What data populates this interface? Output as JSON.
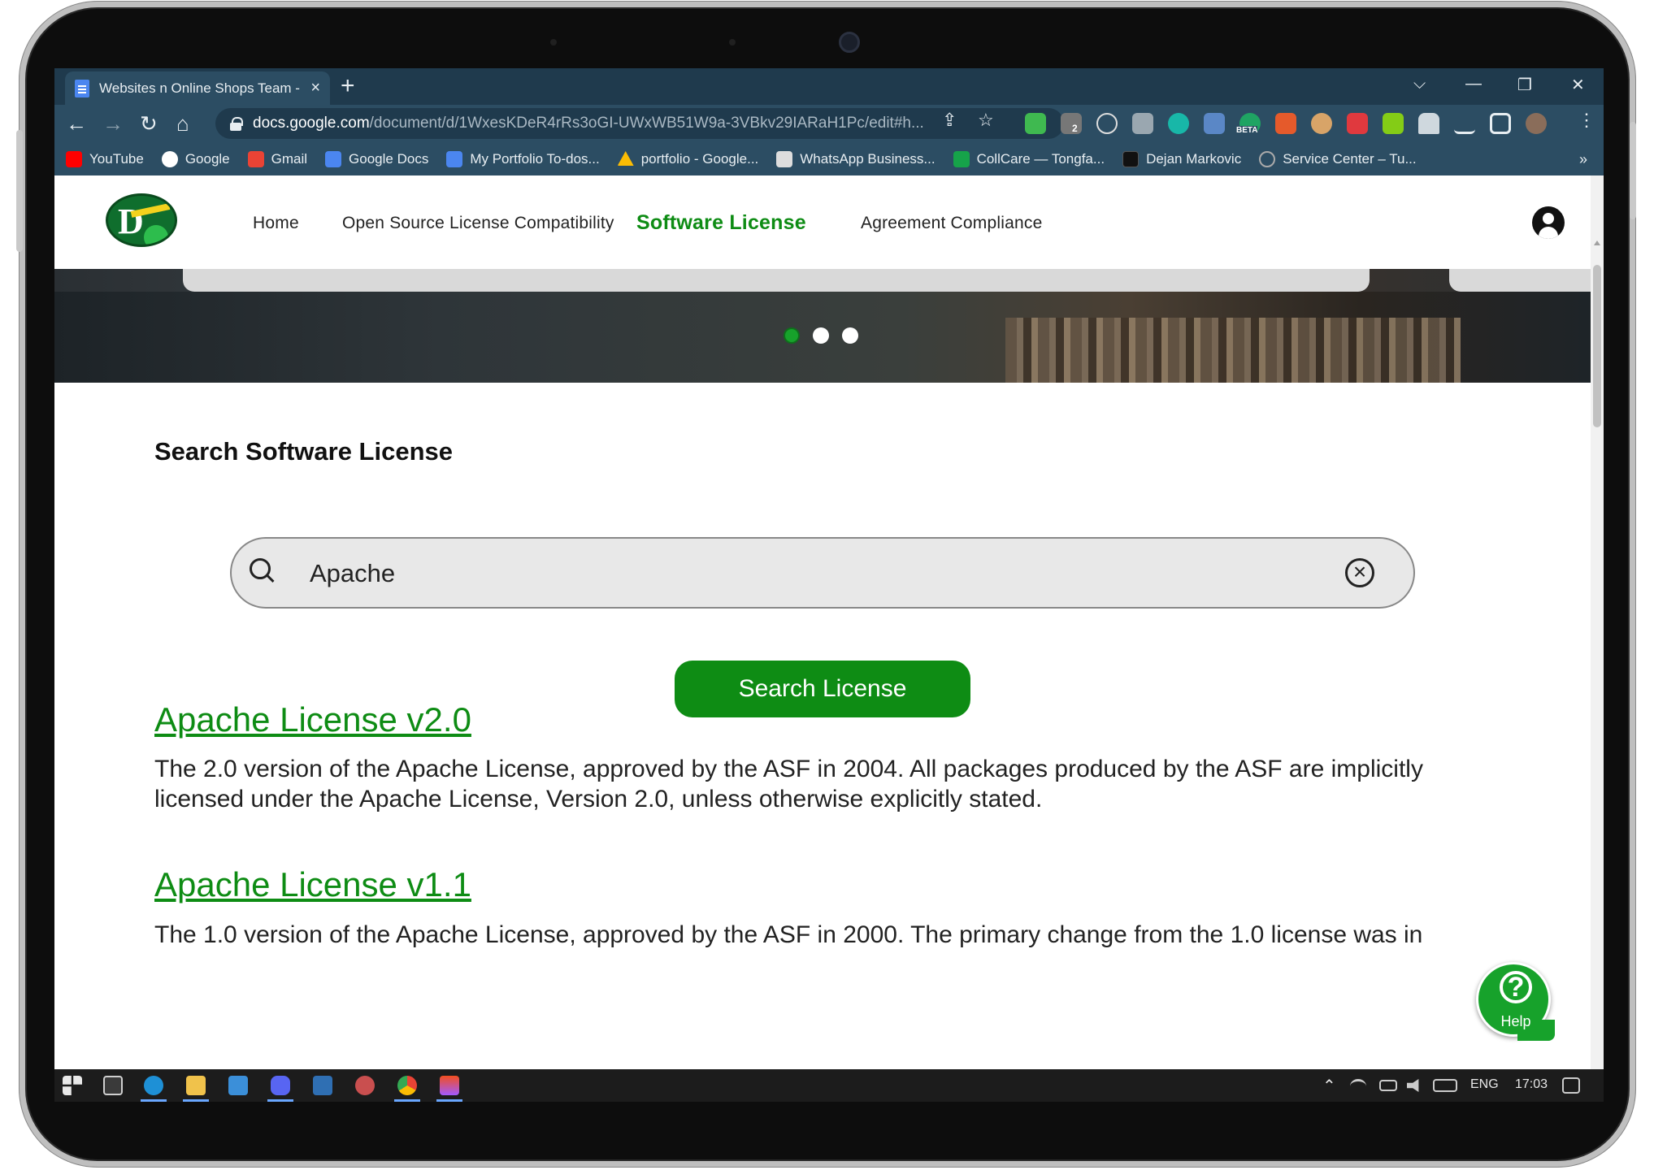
{
  "browser": {
    "tab_title": "Websites n Online Shops Team -",
    "tab_close": "×",
    "new_tab": "+",
    "window_controls": {
      "dropdown": "⌵",
      "minimize": "—",
      "restore": "❐",
      "close": "✕"
    },
    "nav": {
      "back": "←",
      "forward": "→",
      "reload": "↻",
      "home": "⌂"
    },
    "url_host": "docs.google.com",
    "url_path": "/document/d/1WxesKDeR4rRs3oGI-UWxWB51W9a-3VBkv29IARaH1Pc/edit#h...",
    "share_icon": "⇪",
    "star_icon": "☆",
    "extension_badge": "2",
    "extension_beta": "BETA",
    "menu_icon": "⋮",
    "bookmarks": [
      {
        "label": "YouTube",
        "color": "#ff0000"
      },
      {
        "label": "Google",
        "color": "#ffffff"
      },
      {
        "label": "Gmail",
        "color": "#ea4335"
      },
      {
        "label": "Google Docs",
        "color": "#4b86f0"
      },
      {
        "label": "My Portfolio To-dos...",
        "color": "#4b86f0"
      },
      {
        "label": "portfolio - Google...",
        "color": "#fbbc04"
      },
      {
        "label": "WhatsApp Business...",
        "color": "#dddddd"
      },
      {
        "label": "CollCare — Tongfa...",
        "color": "#16a34a"
      },
      {
        "label": "Dejan Markovic",
        "color": "#111111"
      },
      {
        "label": "Service Center – Tu...",
        "color": "#888888"
      }
    ],
    "bookmarks_more": "»"
  },
  "site": {
    "nav": {
      "home": "Home",
      "compatibility": "Open Source License Compatibility",
      "software_license": "Software License",
      "agreement": "Agreement Compliance"
    },
    "section_title": "Search Software License",
    "search": {
      "value": "Apache",
      "placeholder": ""
    },
    "search_button": "Search License",
    "results": [
      {
        "title": "Apache License v2.0",
        "description": "The 2.0 version of the Apache License, approved by the ASF in 2004. All packages produced by the ASF are implicitly licensed under the Apache License, Version 2.0, unless otherwise explicitly stated."
      },
      {
        "title": "Apache License v1.1",
        "description": "The 1.0 version of the Apache License, approved by the ASF in 2000. The primary change from the 1.0 license was in"
      }
    ],
    "help_label": "Help",
    "help_glyph": "?",
    "carousel_active_slide": 1,
    "carousel_slide_count": 3,
    "accent_color": "#0e8c14"
  },
  "taskbar": {
    "language": "ENG",
    "time": "17:03",
    "tray_chevron": "⌃"
  }
}
